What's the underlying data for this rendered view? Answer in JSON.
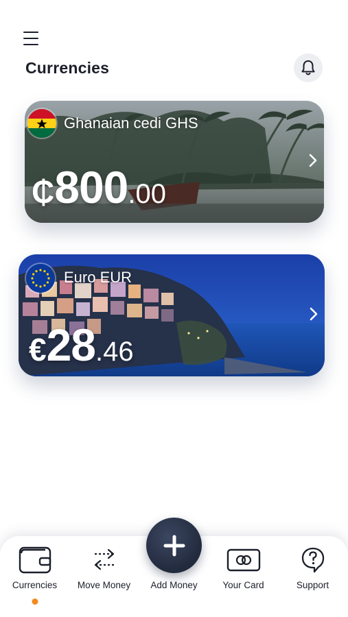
{
  "header": {
    "title": "Currencies",
    "menu_icon": "hamburger-menu-icon",
    "notification_icon": "bell-icon"
  },
  "cards": [
    {
      "currency": "Ghanaian cedi GHS",
      "symbol": "₵",
      "whole": "800",
      "cents": ".00",
      "flag": "ghana-flag-icon"
    },
    {
      "currency": "Euro EUR",
      "symbol": "€",
      "whole": "28",
      "cents": ".46",
      "flag": "eu-flag-icon"
    }
  ],
  "nav": {
    "items": [
      {
        "label": "Currencies",
        "icon": "wallet-icon",
        "active": true
      },
      {
        "label": "Move Money",
        "icon": "transfer-arrows-icon"
      },
      {
        "label": "Add Money",
        "icon": "plus-icon"
      },
      {
        "label": "Your Card",
        "icon": "card-icon"
      },
      {
        "label": "Support",
        "icon": "help-icon"
      }
    ],
    "active_color": "#f28a1e"
  },
  "colors": {
    "text": "#1b1f2a",
    "fab": "#2a3247",
    "bell_bg": "#eceef2"
  }
}
